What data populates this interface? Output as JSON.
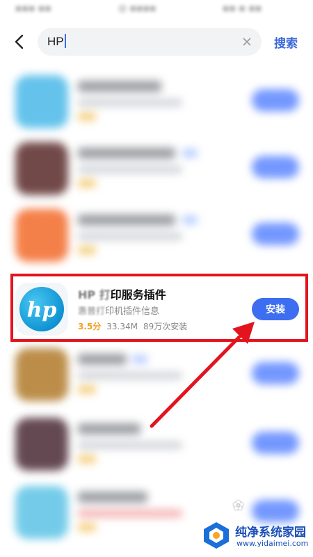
{
  "search": {
    "query": "HP",
    "search_button": "搜索"
  },
  "highlighted_app": {
    "name_faded": "HP 打",
    "name": "印服务插件",
    "desc_faded": "惠普打",
    "desc": "印机插件信息",
    "rating": "3.5分",
    "size": "33.34M",
    "installs": "89万次安装",
    "install_label": "安装"
  },
  "colors": {
    "accent": "#3d6df0",
    "highlight": "#e3141d",
    "rating": "#f0a020"
  },
  "watermark": {
    "title": "纯净系统家园",
    "url": "www.yidaimei.com"
  }
}
